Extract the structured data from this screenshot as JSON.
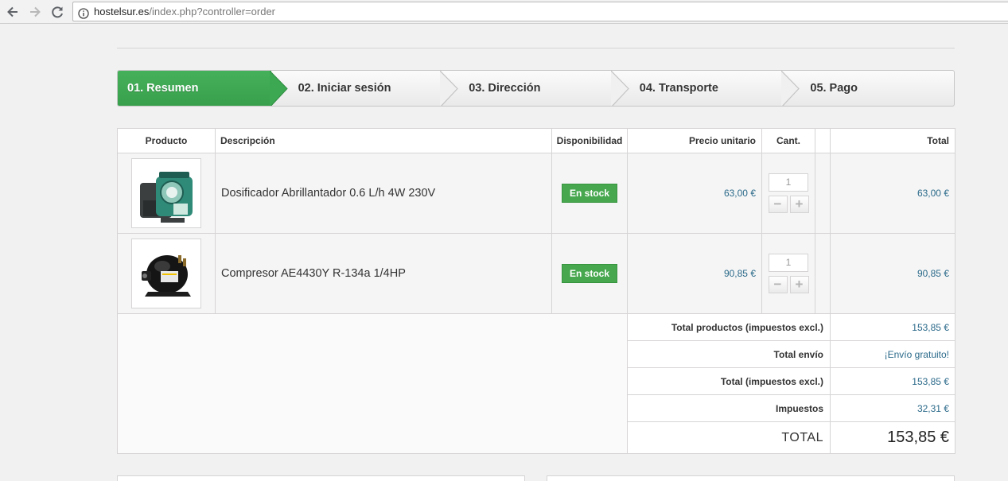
{
  "browser": {
    "url_host": "hostelsur.es",
    "url_path": "/index.php?controller=order"
  },
  "steps": [
    {
      "label": "01. Resumen"
    },
    {
      "label": "02. Iniciar sesión"
    },
    {
      "label": "03. Dirección"
    },
    {
      "label": "04. Transporte"
    },
    {
      "label": "05. Pago"
    }
  ],
  "cart": {
    "headers": {
      "product": "Producto",
      "description": "Descripción",
      "availability": "Disponibilidad",
      "unit_price": "Precio unitario",
      "qty": "Cant.",
      "total": "Total"
    },
    "items": [
      {
        "image_icon": "dosing-pump-product-image",
        "description": "Dosificador Abrillantador 0.6 L/h 4W 230V",
        "stock": "En stock",
        "unit_price": "63,00 €",
        "qty": "1",
        "total": "63,00 €"
      },
      {
        "image_icon": "compressor-product-image",
        "description": "Compresor AE4430Y R-134a 1/4HP",
        "stock": "En stock",
        "unit_price": "90,85 €",
        "qty": "1",
        "total": "90,85 €"
      }
    ],
    "qty_minus": "−",
    "qty_plus": "+",
    "summary": {
      "products_excl_label": "Total productos (impuestos excl.)",
      "products_excl_value": "153,85 €",
      "shipping_label": "Total envío",
      "shipping_value": "¡Envío gratuito!",
      "total_excl_label": "Total (impuestos excl.)",
      "total_excl_value": "153,85 €",
      "tax_label": "Impuestos",
      "tax_value": "32,31 €",
      "total_label": "TOTAL",
      "total_value": "153,85 €"
    }
  },
  "colors": {
    "step_active": "#3ca852",
    "stock_badge": "#46a74e",
    "price_text": "#2b6a8a"
  }
}
